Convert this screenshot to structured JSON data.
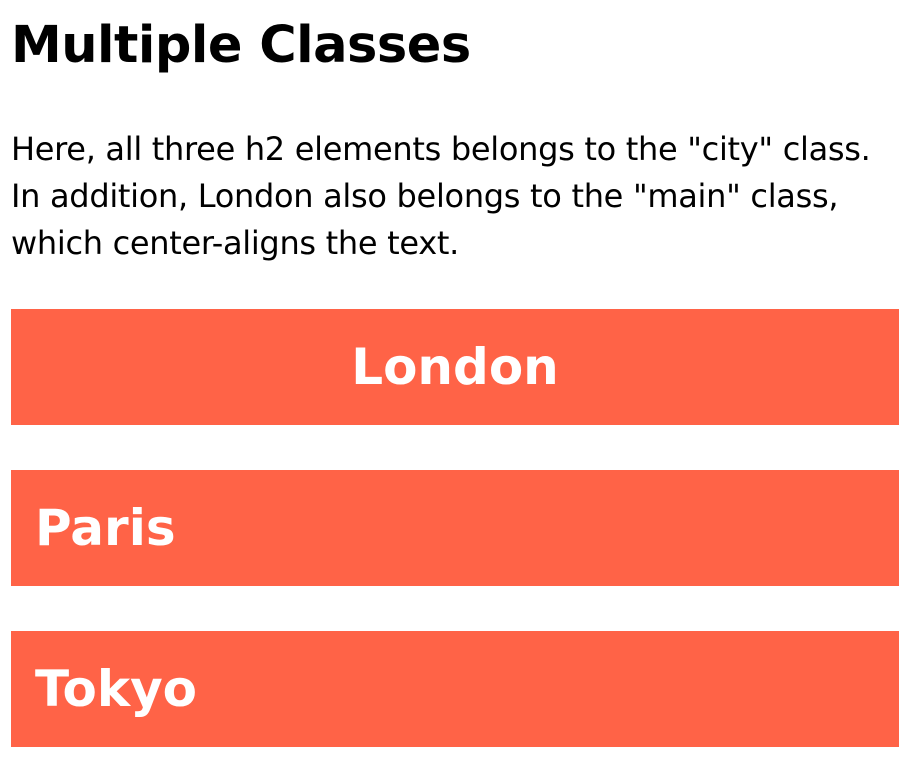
{
  "heading": "Multiple Classes",
  "intro": "Here, all three h2 elements belongs to the \"city\" class. In addition, London also belongs to the \"main\" class, which center-aligns the text.",
  "cities": [
    {
      "name": "London"
    },
    {
      "name": "Paris"
    },
    {
      "name": "Tokyo"
    }
  ],
  "colors": {
    "city_background": "#ff6347",
    "city_text": "#ffffff",
    "page_background": "#ffffff",
    "text": "#000000"
  }
}
